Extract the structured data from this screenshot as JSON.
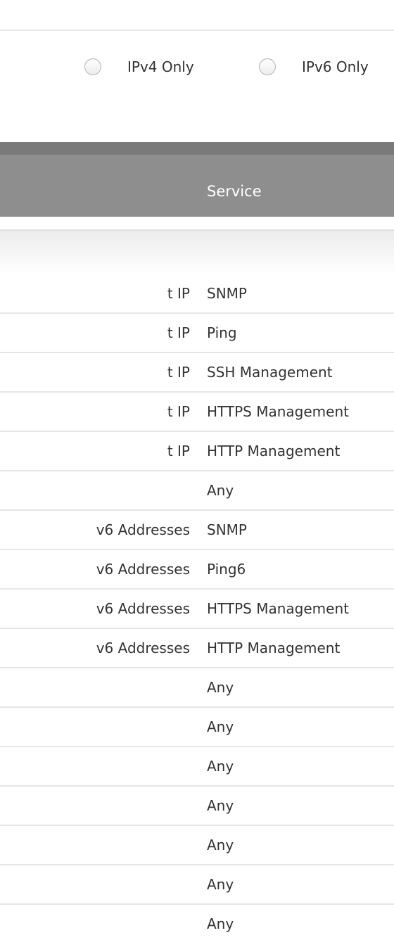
{
  "ip_version_options": [
    {
      "label": "IPv4 Only",
      "selected": false
    },
    {
      "label": "IPv6 Only",
      "selected": false
    }
  ],
  "table": {
    "headers": {
      "service": "Service"
    },
    "rows": [
      {
        "destination": "t IP",
        "service": "SNMP"
      },
      {
        "destination": "t IP",
        "service": "Ping"
      },
      {
        "destination": "t IP",
        "service": "SSH Management"
      },
      {
        "destination": "t IP",
        "service": "HTTPS Management"
      },
      {
        "destination": "t IP",
        "service": "HTTP Management"
      },
      {
        "destination": "",
        "service": "Any"
      },
      {
        "destination": "v6 Addresses",
        "service": "SNMP"
      },
      {
        "destination": "v6 Addresses",
        "service": "Ping6"
      },
      {
        "destination": "v6 Addresses",
        "service": "HTTPS Management"
      },
      {
        "destination": "v6 Addresses",
        "service": "HTTP Management"
      },
      {
        "destination": "",
        "service": "Any"
      },
      {
        "destination": "",
        "service": "Any"
      },
      {
        "destination": "",
        "service": "Any"
      },
      {
        "destination": "",
        "service": "Any"
      },
      {
        "destination": "",
        "service": "Any"
      },
      {
        "destination": "",
        "service": "Any"
      },
      {
        "destination": "",
        "service": "Any"
      }
    ]
  }
}
